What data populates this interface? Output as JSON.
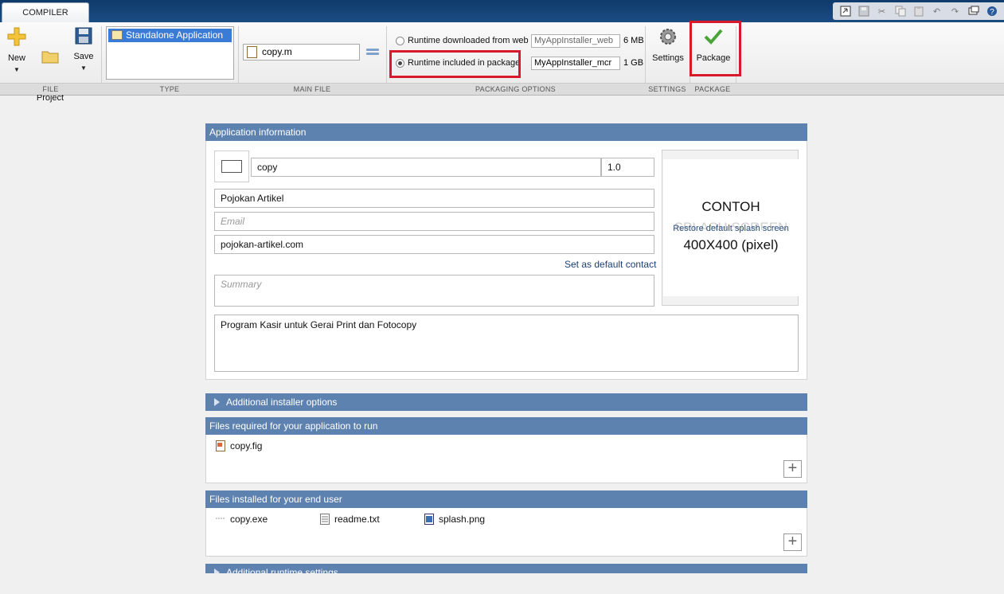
{
  "tab": {
    "label": "COMPILER"
  },
  "file_section": {
    "new_label": "New",
    "open_label": "Open\nProject",
    "save_label": "Save"
  },
  "type_section": {
    "selected": "Standalone Application"
  },
  "main_file": {
    "value": "copy.m"
  },
  "packaging": {
    "web_label": "Runtime downloaded from web",
    "web_installer": "MyAppInstaller_web",
    "web_size": "6 MB",
    "pkg_label": "Runtime included in package",
    "pkg_installer": "MyAppInstaller_mcr",
    "pkg_size": "1 GB"
  },
  "settings": {
    "label": "Settings"
  },
  "package": {
    "label": "Package"
  },
  "sections": {
    "file": "FILE",
    "type": "TYPE",
    "main_file": "MAIN FILE",
    "packaging_options": "PACKAGING OPTIONS",
    "settings": "SETTINGS",
    "package": "PACKAGE"
  },
  "app_info": {
    "header": "Application information",
    "app_name": "copy",
    "version": "1.0",
    "author": "Pojokan Artikel",
    "email_placeholder": "Email",
    "company": "pojokan-artikel.com",
    "set_default": "Set as default contact",
    "summary_placeholder": "Summary",
    "description": "Program Kasir untuk Gerai Print dan Fotocopy",
    "splash_line1": "CONTOH",
    "splash_line2": "SPLASH SCREEN",
    "splash_restore": "Restore default splash screen",
    "splash_line3": "400X400 (pixel)"
  },
  "additional_installer": {
    "header": "Additional installer options"
  },
  "files_required": {
    "header": "Files required for your application to run",
    "files": [
      "copy.fig"
    ]
  },
  "files_installed": {
    "header": "Files installed for your end user",
    "files": [
      "copy.exe",
      "readme.txt",
      "splash.png"
    ]
  },
  "additional_runtime": {
    "header": "Additional runtime settings"
  },
  "colors": {
    "header_blue": "#5d82b0",
    "highlight_red": "#d8192c",
    "selection_blue": "#3a7bd5"
  }
}
